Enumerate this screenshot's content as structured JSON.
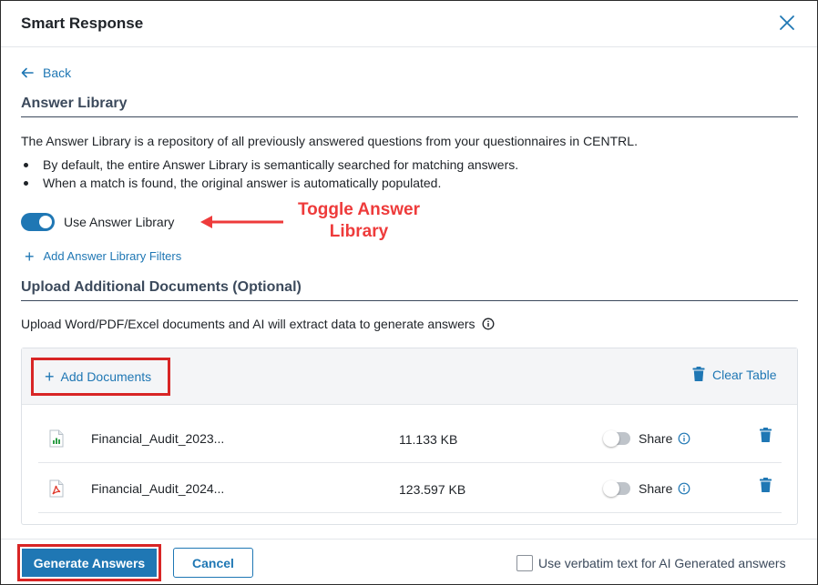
{
  "dialog": {
    "title": "Smart Response",
    "back_label": "Back"
  },
  "answer_library": {
    "heading": "Answer Library",
    "description": "The Answer Library is a repository of all previously answered questions from your questionnaires in CENTRL.",
    "bullets": [
      "By default, the entire Answer Library is semantically searched for matching answers.",
      "When a match is found, the original answer is automatically populated."
    ],
    "toggle_label": "Use Answer Library",
    "toggle_on": true,
    "add_filters_label": "Add Answer Library Filters"
  },
  "annotation": {
    "line1": "Toggle Answer",
    "line2": "Library",
    "color": "#ee3b3b"
  },
  "upload": {
    "heading": "Upload Additional Documents (Optional)",
    "description": "Upload Word/PDF/Excel documents and AI will extract data to generate answers",
    "add_documents_label": "Add Documents",
    "clear_table_label": "Clear Table",
    "files": [
      {
        "name": "Financial_Audit_2023...",
        "size": "11.133 KB",
        "type": "excel",
        "icon": "excel-file-icon",
        "share_label": "Share",
        "shared": false
      },
      {
        "name": "Financial_Audit_2024...",
        "size": "123.597 KB",
        "type": "pdf",
        "icon": "pdf-file-icon",
        "share_label": "Share",
        "shared": false
      }
    ]
  },
  "footer": {
    "generate_label": "Generate Answers",
    "cancel_label": "Cancel",
    "verbatim_label": "Use verbatim text for AI Generated answers",
    "verbatim_checked": false
  },
  "colors": {
    "accent": "#1f77b4",
    "highlight_box": "#d82525",
    "section_heading": "#3c4a5c"
  }
}
